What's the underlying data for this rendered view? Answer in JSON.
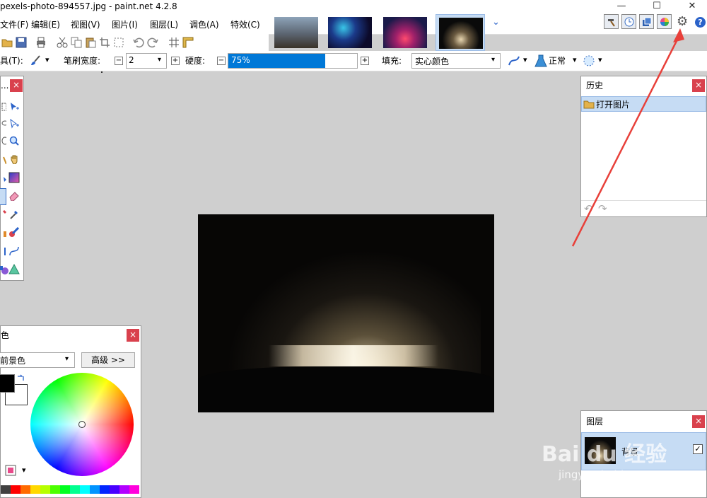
{
  "window": {
    "title": "pexels-photo-894557.jpg - paint.net 4.2.8",
    "minimize_glyph": "—",
    "maximize_glyph": "☐",
    "close_glyph": "✕"
  },
  "menu": [
    {
      "label": "文件(F)"
    },
    {
      "label": "编辑(E)"
    },
    {
      "label": "视图(V)"
    },
    {
      "label": "图片(I)"
    },
    {
      "label": "图层(L)"
    },
    {
      "label": "调色(A)"
    },
    {
      "label": "特效(C)"
    }
  ],
  "thumbnails_dropdown_glyph": "⌄",
  "right_buttons": {
    "tools_icon": "hammer-icon",
    "history_icon": "clock-icon",
    "layers_icon": "layers-icon",
    "colors_icon": "color-wheel-icon",
    "settings_glyph": "⚙",
    "help_glyph": "?"
  },
  "toolbar": {
    "tool_label": "具(T):",
    "brush_width_label": "笔刷宽度:",
    "brush_width_value": "2",
    "hardness_label": "硬度:",
    "hardness_value": "75%",
    "hardness_fraction": 0.75,
    "fill_label": "填充:",
    "fill_value": "实心颜色",
    "blend_value": "正常",
    "minus_glyph": "−",
    "plus_glyph": "+",
    "dropdown_glyph": "▾"
  },
  "tools_panel": {
    "title": "...",
    "close_glyph": "×"
  },
  "history_panel": {
    "title": "历史",
    "close_glyph": "×",
    "items": [
      {
        "label": "打开图片"
      }
    ],
    "undo_glyph": "↶",
    "redo_glyph": "↷"
  },
  "colors_panel": {
    "title": "色",
    "close_glyph": "×",
    "mode_value": "前景色",
    "advanced_label": "高级 >>",
    "primary_color": "#000000",
    "secondary_color": "#ffffff"
  },
  "layers_panel": {
    "title": "图层",
    "close_glyph": "×",
    "items": [
      {
        "label": "背景",
        "visible": true
      }
    ],
    "check_glyph": "✓"
  },
  "watermark": {
    "brand": "Bai du 经验",
    "url": "jingyan.baidu.com"
  },
  "colors": {
    "accent": "#0078d7",
    "close_red": "#d9414d",
    "selection_blue": "#c6dcf4",
    "annotation_red": "#e8403a",
    "canvas_bg": "#cfcfcf"
  }
}
